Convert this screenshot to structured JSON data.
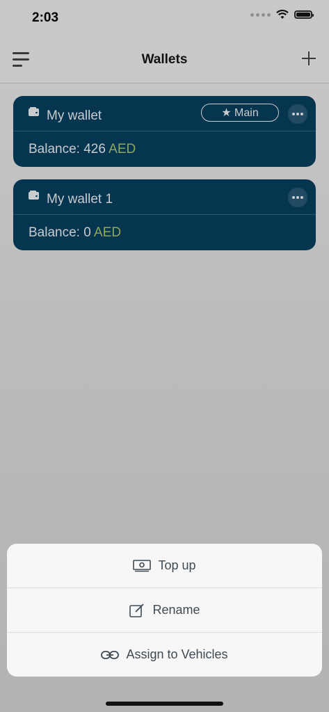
{
  "status": {
    "time": "2:03"
  },
  "header": {
    "title": "Wallets"
  },
  "wallets": [
    {
      "name": "My wallet",
      "badge": "★ Main",
      "balance_label": "Balance: 426",
      "currency": "AED"
    },
    {
      "name": "My wallet 1",
      "balance_label": "Balance: 0",
      "currency": "AED"
    }
  ],
  "actions": [
    {
      "label": "Top up",
      "icon": "cash-icon"
    },
    {
      "label": "Rename",
      "icon": "edit-icon"
    },
    {
      "label": "Assign to Vehicles",
      "icon": "link-icon"
    }
  ],
  "colors": {
    "card": "#06364f",
    "currency": "#8ea85e",
    "sheet": "#f7f7f7"
  }
}
